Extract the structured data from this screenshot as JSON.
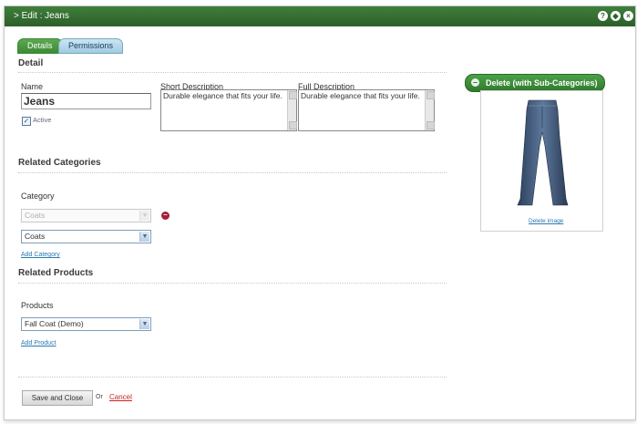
{
  "window": {
    "title": "> Edit : Jeans"
  },
  "tabs": [
    {
      "label": "Details"
    },
    {
      "label": "Permissions"
    }
  ],
  "detail": {
    "section_title": "Detail",
    "name_label": "Name",
    "name_value": "Jeans",
    "active_label": "Active",
    "short_desc_label": "Short Description",
    "short_desc_value": "Durable elegance that fits your life.",
    "full_desc_label": "Full Description",
    "full_desc_value": "Durable elegance that fits your life."
  },
  "related_categories": {
    "section_title": "Related Categories",
    "category_label": "Category",
    "disabled_select_value": "Coats",
    "select_value": "Coats",
    "add_link": "Add Category"
  },
  "related_products": {
    "section_title": "Related Products",
    "products_label": "Products",
    "select_value": "Fall Coat (Demo)",
    "add_link": "Add Product"
  },
  "footer": {
    "save_label": "Save and Close",
    "or_text": "Or",
    "cancel_label": "Cancel"
  },
  "sidebar": {
    "delete_label": "Delete (with Sub-Categories)",
    "delete_image_label": "Delete image"
  },
  "colors": {
    "header_green": "#2c5f2a",
    "link_blue": "#2a7ab0",
    "remove_red": "#a41f3c"
  }
}
